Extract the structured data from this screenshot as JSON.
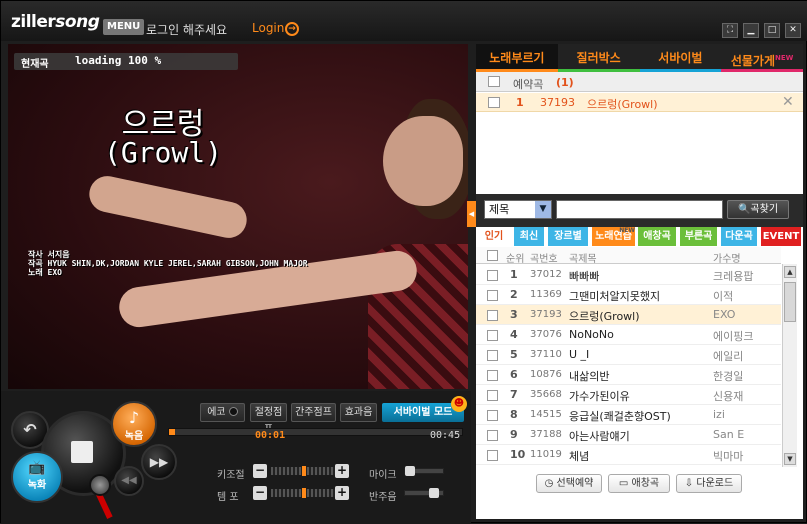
{
  "app": {
    "logo_prefix": "ziller",
    "logo_suffix": "song",
    "menu_label": "MENU",
    "login_prompt": "로그인 해주세요",
    "login_link": "Login"
  },
  "window_controls": [
    "fullscreen",
    "minimize",
    "maximize",
    "close"
  ],
  "video": {
    "now_label": "현재곡",
    "loading_text": "loading 100 %",
    "song_title": "으르렁",
    "song_subtitle": "(Growl)",
    "credits": [
      "작사 서지음",
      "작곡 HYUK SHIN,DK,JORDAN KYLE JEREL,SARAH GIBSON,JOHN MAJOR",
      "노래 EXO"
    ]
  },
  "controls": {
    "echo_label": "에코",
    "fx_buttons": [
      "절정점프",
      "간주점프",
      "효과음"
    ],
    "survival_label": "서바이벌 모드",
    "time_current": "00:01",
    "time_total": "00:45",
    "progress": 0.02,
    "record_label": "녹음",
    "video_record_label": "녹화",
    "key_label": "키조절",
    "tempo_label": "템 포",
    "mic_label": "마이크",
    "accomp_label": "반주음"
  },
  "tabs": [
    {
      "label": "노래부르기",
      "color": "#ff8a1a",
      "line": "#ff8a1a",
      "active": true
    },
    {
      "label": "질러박스",
      "color": "#ff8a1a",
      "line": "#3fbf3f"
    },
    {
      "label": "서바이벌",
      "color": "#ff8a1a",
      "line": "#16a3d6"
    },
    {
      "label": "선물가게",
      "color": "#ff8a1a",
      "line": "#e0286a",
      "badge": "NEW"
    }
  ],
  "reservation": {
    "title": "예약곡",
    "count": "(1)",
    "items": [
      {
        "num": "1",
        "code": "37193",
        "title": "으르렁(Growl)"
      }
    ]
  },
  "search": {
    "field": "제목",
    "button": "곡찾기"
  },
  "categories": [
    {
      "label": "인기",
      "bg": "#ffffff",
      "fg": "#e2521b"
    },
    {
      "label": "최신",
      "bg": "#3db5e6",
      "fg": "#ffffff"
    },
    {
      "label": "장르별",
      "bg": "#3db5e6",
      "fg": "#ffffff"
    },
    {
      "label": "노래연습",
      "bg": "#ff8a1a",
      "fg": "#ffffff",
      "badge": "NEW"
    },
    {
      "label": "애창곡",
      "bg": "#6bbf3a",
      "fg": "#ffffff"
    },
    {
      "label": "부른곡",
      "bg": "#6bbf3a",
      "fg": "#ffffff"
    },
    {
      "label": "다운곡",
      "bg": "#3db5e6",
      "fg": "#ffffff"
    },
    {
      "label": "EVENT",
      "bg": "#e02020",
      "fg": "#ffffff"
    }
  ],
  "table": {
    "headers": [
      "순위",
      "곡번호",
      "곡제목",
      "가수명"
    ],
    "rows": [
      {
        "rank": "1",
        "code": "37012",
        "title": "빠빠빠",
        "artist": "크레용팝"
      },
      {
        "rank": "2",
        "code": "11369",
        "title": "그땐미처알지못했지",
        "artist": "이적"
      },
      {
        "rank": "3",
        "code": "37193",
        "title": "으르렁(Growl)",
        "artist": "EXO",
        "highlight": true
      },
      {
        "rank": "4",
        "code": "37076",
        "title": "NoNoNo",
        "artist": "에이핑크"
      },
      {
        "rank": "5",
        "code": "37110",
        "title": "U _I",
        "artist": "에일리"
      },
      {
        "rank": "6",
        "code": "10876",
        "title": "내삶의반",
        "artist": "한경일"
      },
      {
        "rank": "7",
        "code": "35668",
        "title": "가수가된이유",
        "artist": "신용재"
      },
      {
        "rank": "8",
        "code": "14515",
        "title": "응급실(쾌걸춘향OST)",
        "artist": "izi"
      },
      {
        "rank": "9",
        "code": "37188",
        "title": "아는사람얘기",
        "artist": "San E"
      },
      {
        "rank": "10",
        "code": "11019",
        "title": "체념",
        "artist": "빅마마"
      }
    ]
  },
  "footer_buttons": [
    {
      "label": "선택예약",
      "icon": "clock-icon"
    },
    {
      "label": "애창곡",
      "icon": "folder-icon"
    },
    {
      "label": "다운로드",
      "icon": "download-icon"
    }
  ]
}
